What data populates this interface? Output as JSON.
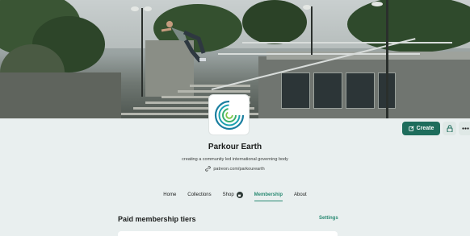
{
  "profile": {
    "name": "Parkour Earth",
    "tagline": "creating a community led international governing body",
    "link": "patreon.com/parkourearth"
  },
  "actions": {
    "create_label": "Create"
  },
  "tabs": [
    {
      "label": "Home"
    },
    {
      "label": "Collections"
    },
    {
      "label": "Shop"
    },
    {
      "label": "Membership"
    },
    {
      "label": "About"
    }
  ],
  "section": {
    "title": "Paid membership tiers",
    "settings_label": "Settings"
  },
  "colors": {
    "accent": "#1e6d5c",
    "accent_text": "#2a8a73",
    "background": "#e9efef"
  },
  "icons": [
    "edit-icon",
    "lock-icon",
    "more-icon",
    "link-icon",
    "shop-badge-icon"
  ]
}
